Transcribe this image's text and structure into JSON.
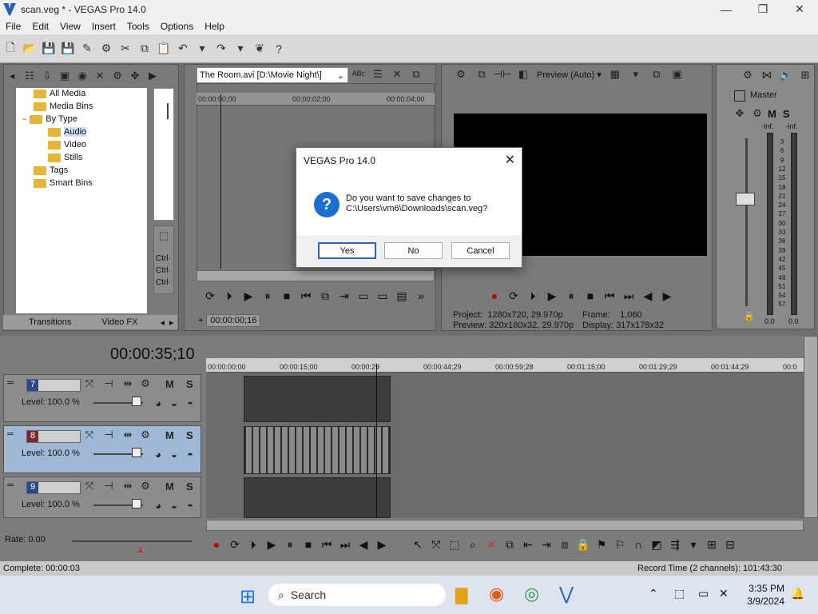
{
  "window": {
    "title": "scan.veg * - VEGAS Pro 14.0",
    "min": "—",
    "max": "❐",
    "close": "✕"
  },
  "menu": [
    "File",
    "Edit",
    "View",
    "Insert",
    "Tools",
    "Options",
    "Help"
  ],
  "explorer": {
    "tree": [
      {
        "label": "All Media"
      },
      {
        "label": "Media Bins"
      },
      {
        "label": "By Type"
      },
      {
        "label": "Audio"
      },
      {
        "label": "Video"
      },
      {
        "label": "Stills"
      },
      {
        "label": "Tags"
      },
      {
        "label": "Smart Bins"
      }
    ],
    "tabs": [
      "Transitions",
      "Video FX"
    ],
    "side_labels": [
      "Ctrl·",
      "Ctrl·",
      "Ctrl·"
    ],
    "tree_toggle": "−"
  },
  "trimmer": {
    "media": "The Room.avi   [D:\\Movie Night\\]",
    "ruler": [
      "00:00:00;00",
      "00:00:02;00",
      "00:00:04;00"
    ],
    "timecode": "00:00:00;16"
  },
  "preview": {
    "mode": "Preview (Auto)",
    "project_label": "Project:",
    "project_value": "1280x720, 29.970p",
    "frame_label": "Frame:",
    "frame_value": "1,060",
    "preview_label": "Preview:",
    "preview_value": "320x180x32, 29.970p",
    "display_label": "Display:",
    "display_value": "317x178x32"
  },
  "mixer": {
    "title": "Master",
    "inf_left": "-Inf.",
    "inf_right": "-Inf.",
    "scale": [
      "3",
      "6",
      "9",
      "12",
      "15",
      "18",
      "21",
      "24",
      "27",
      "30",
      "33",
      "36",
      "39",
      "42",
      "45",
      "48",
      "51",
      "54",
      "57"
    ],
    "val_left": "0.0",
    "val_right": "0.0"
  },
  "timeline": {
    "cursor_time": "00:00:35;10",
    "ruler": [
      "00:00:00;00",
      "00:00:15;00",
      "00:00:29",
      "00:00:44;29",
      "00:00:59;28",
      "00:01:15;00",
      "00:01:29;29",
      "00:01:44;29",
      "00:0"
    ],
    "tracks": [
      {
        "number": "7",
        "level": "Level: 100.0 %"
      },
      {
        "number": "8",
        "level": "Level: 100.0 %"
      },
      {
        "number": "9",
        "level": "Level: 100.0 %"
      }
    ],
    "rate": "Rate: 0.00"
  },
  "status": {
    "left": "Complete: 00:00:03",
    "right": "Record Time (2 channels): 101:43:30"
  },
  "dialog": {
    "title": "VEGAS Pro 14.0",
    "line1": "Do you want to save changes to",
    "line2": "C:\\Users\\vm6\\Downloads\\scan.veg?",
    "yes": "Yes",
    "no": "No",
    "cancel": "Cancel"
  },
  "taskbar": {
    "search": "Search",
    "time": "3:35 PM",
    "date": "3/9/2024"
  }
}
